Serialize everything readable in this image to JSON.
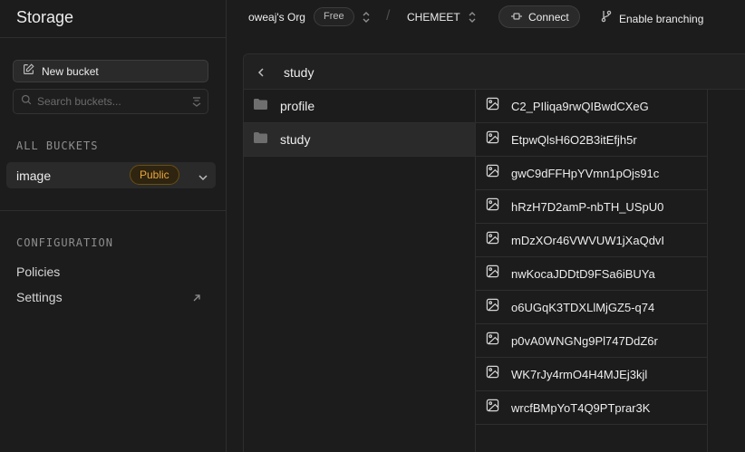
{
  "sidebar": {
    "title": "Storage",
    "new_bucket_label": "New bucket",
    "search_placeholder": "Search buckets...",
    "all_buckets_label": "ALL BUCKETS",
    "buckets": [
      {
        "name": "image",
        "badge": "Public"
      }
    ],
    "configuration_label": "CONFIGURATION",
    "config_links": [
      "Policies",
      "Settings"
    ]
  },
  "topbar": {
    "org": "oweaj's Org",
    "plan_badge": "Free",
    "project": "CHEMEET",
    "connect_label": "Connect",
    "branching_label": "Enable branching"
  },
  "explorer": {
    "breadcrumb": "study",
    "folders": [
      {
        "name": "profile",
        "selected": false
      },
      {
        "name": "study",
        "selected": true
      }
    ],
    "files": [
      "C2_PIliqa9rwQIBwdCXeG",
      "EtpwQlsH6O2B3itEfjh5r",
      "gwC9dFFHpYVmn1pOjs91c",
      "hRzH7D2amP-nbTH_USpU0",
      "mDzXOr46VWVUW1jXaQdvI",
      "nwKocaJDDtD9FSa6iBUYa",
      "o6UGqK3TDXLlMjGZ5-q74",
      "p0vA0WNGNg9Pl747DdZ6r",
      "WK7rJy4rmO4H4MJEj3kjl",
      "wrcfBMpYoT4Q9PTprar3K"
    ]
  },
  "colors": {
    "background": "#1c1c1c",
    "panel": "#212121",
    "border": "#2e2e2e",
    "selected": "#2a2a2a",
    "public_badge_text": "#e8a63c",
    "text": "#ededed",
    "muted": "#8f8f8f"
  },
  "icons": {
    "new_bucket": "edit-icon",
    "search": "search-icon",
    "sort": "sort-icon",
    "chevron": "chevron-down-icon",
    "external": "arrow-up-right-icon",
    "updown": "chevron-up-down-icon",
    "connect": "plug-icon",
    "branch": "git-branch-icon",
    "back": "chevron-left-icon",
    "folder": "folder-icon",
    "image": "image-file-icon"
  }
}
